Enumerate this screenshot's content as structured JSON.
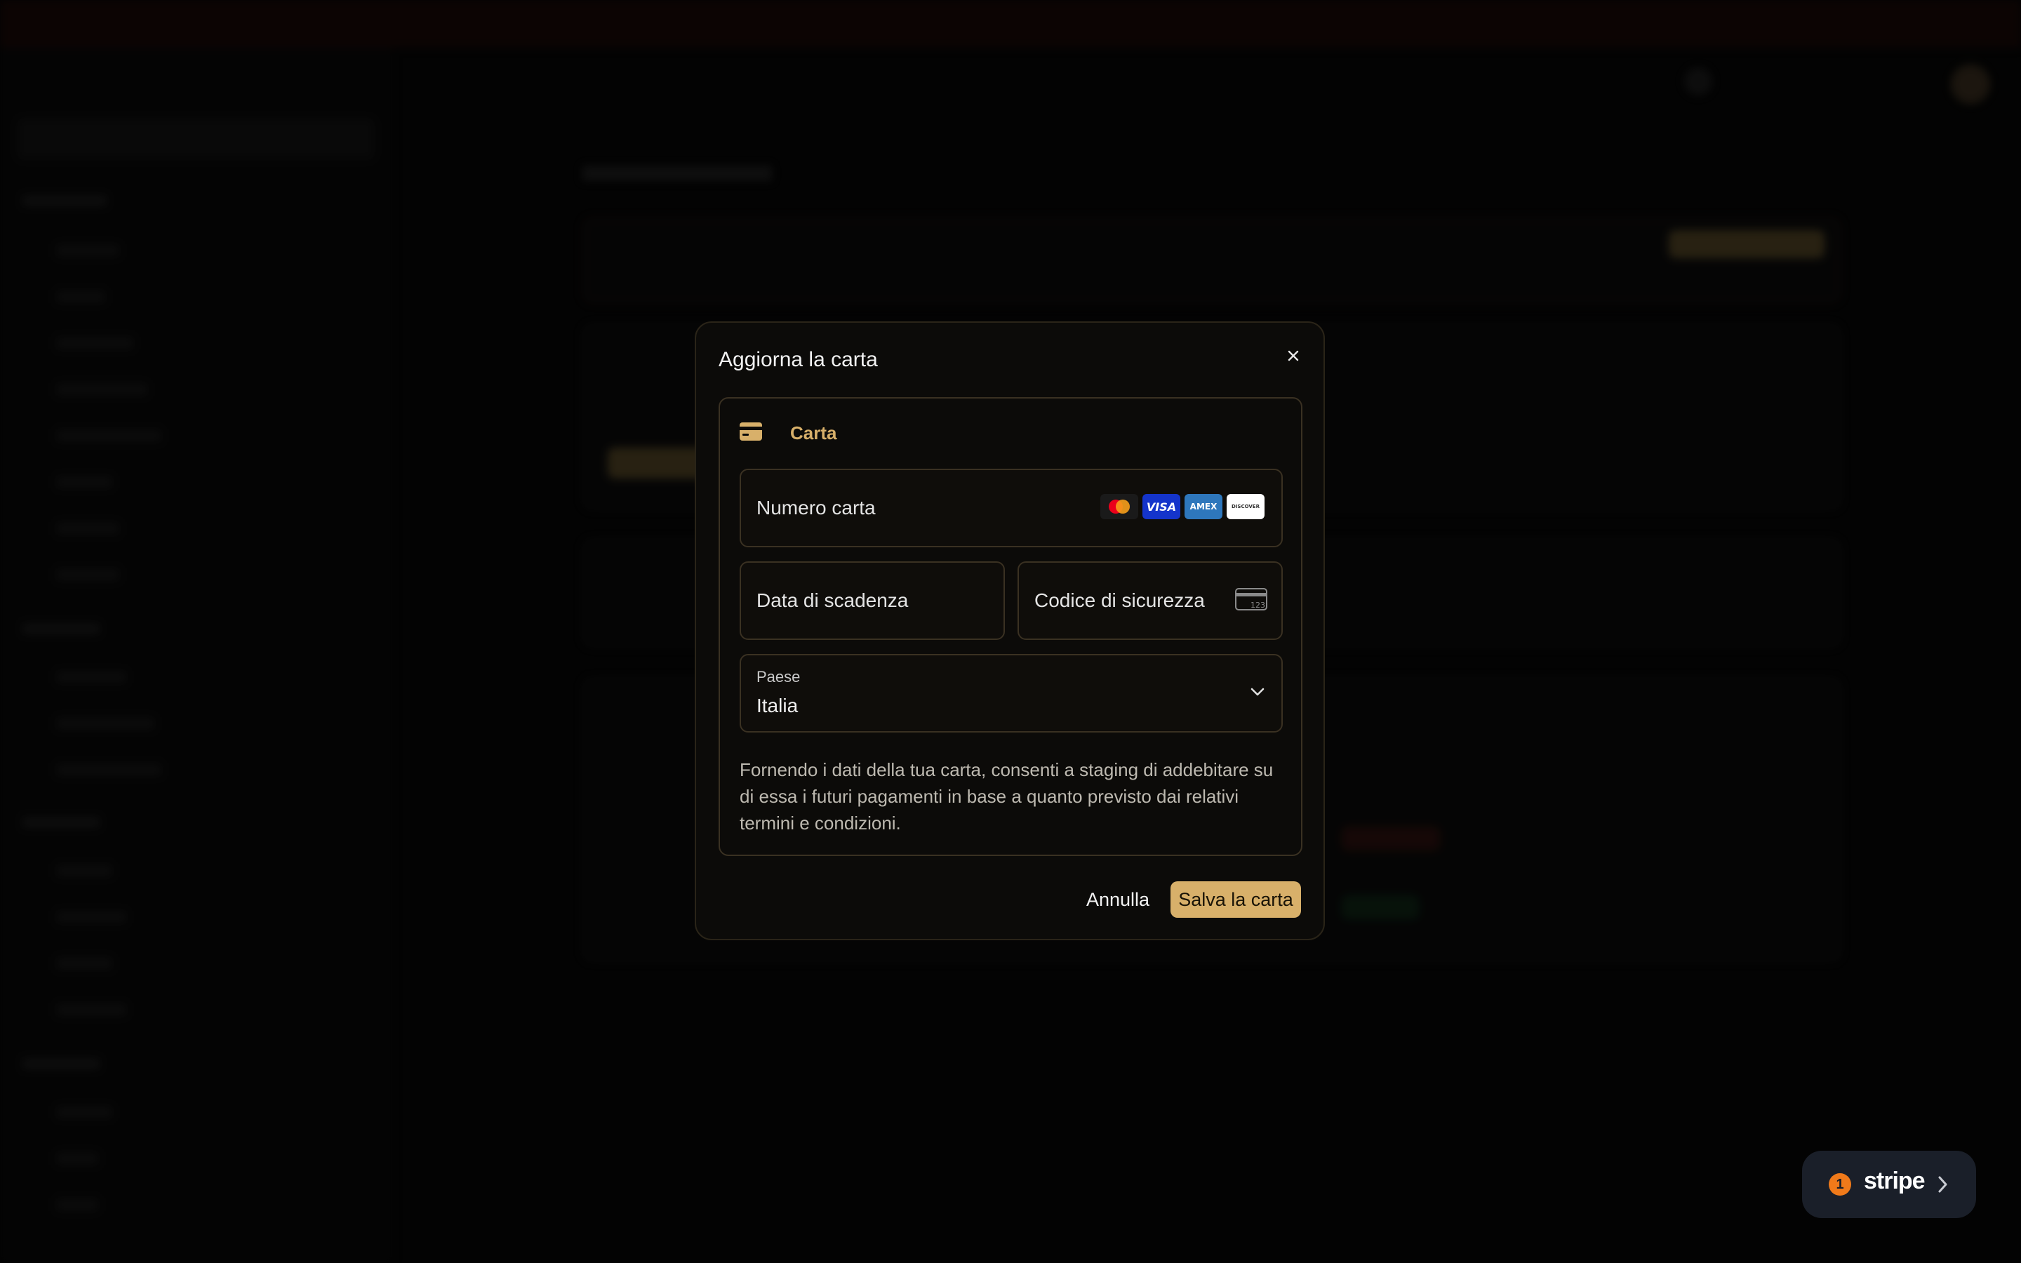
{
  "modal": {
    "title": "Aggiorna la carta",
    "close_icon": "close-icon",
    "section_label": "Carta",
    "section_icon": "credit-card-icon",
    "card_number_placeholder": "Numero carta",
    "card_brands": [
      "mastercard",
      "visa",
      "amex",
      "discover"
    ],
    "brand_labels": {
      "visa": "VISA",
      "amex": "AMEX",
      "discover": "DISCOVER"
    },
    "expiry_placeholder": "Data di scadenza",
    "cvc_placeholder": "Codice di sicurezza",
    "cvc_icon": "cvc-card-icon",
    "cvc_icon_digits": "123",
    "country_label": "Paese",
    "country_value": "Italia",
    "disclaimer": "Fornendo i dati della tua carta, consenti a staging di addebitare su di essa i futuri pagamenti in base a quanto previsto dai relativi termini e condizioni.",
    "cancel_label": "Annulla",
    "save_label": "Salva la carta"
  },
  "stripe_badge": {
    "count": "1",
    "wordmark": "stripe",
    "chevron_icon": "chevron-right-icon"
  },
  "colors": {
    "accent_gold": "#d8b06a",
    "modal_bg": "#0c0b09",
    "field_border": "#3a3122",
    "badge_orange": "#f07a1a"
  }
}
